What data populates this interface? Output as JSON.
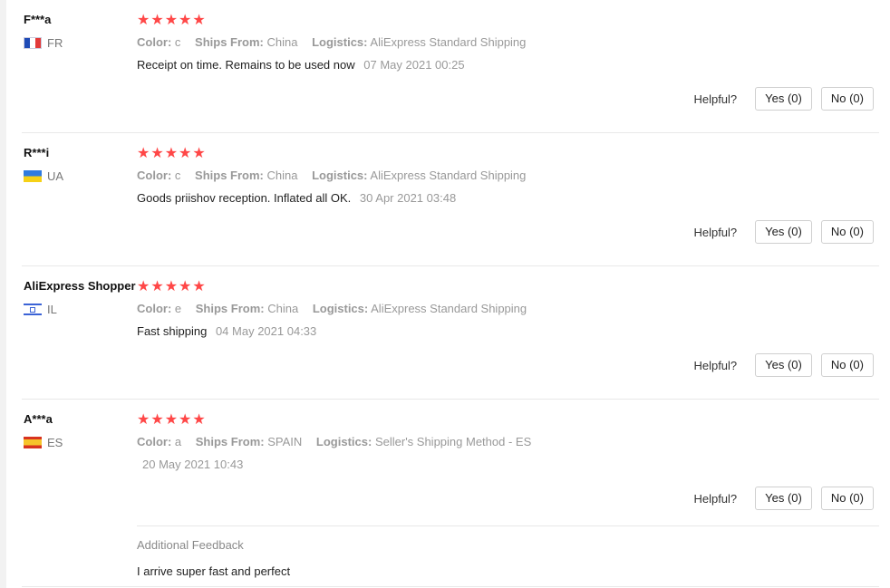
{
  "reviews": [
    {
      "user": "F***a",
      "country": "FR",
      "flag": "france-flag",
      "stars": "★★★★★",
      "rating": 5,
      "color_label": "Color:",
      "color_value": "c",
      "ships_label": "Ships From:",
      "ships_value": "China",
      "logistics_label": "Logistics:",
      "logistics_value": "AliExpress Standard Shipping",
      "comment": "Receipt on time. Remains to be used now",
      "date": "07 May 2021 00:25",
      "helpful_label": "Helpful?",
      "yes_label": "Yes (0)",
      "no_label": "No (0)"
    },
    {
      "user": "R***i",
      "country": "UA",
      "flag": "ukraine-flag",
      "stars": "★★★★★",
      "rating": 5,
      "color_label": "Color:",
      "color_value": "c",
      "ships_label": "Ships From:",
      "ships_value": "China",
      "logistics_label": "Logistics:",
      "logistics_value": "AliExpress Standard Shipping",
      "comment": "Goods priishov reception. Inflated all OK.",
      "date": "30 Apr 2021 03:48",
      "helpful_label": "Helpful?",
      "yes_label": "Yes (0)",
      "no_label": "No (0)"
    },
    {
      "user": "AliExpress Shopper",
      "country": "IL",
      "flag": "israel-flag",
      "stars": "★★★★★",
      "rating": 5,
      "color_label": "Color:",
      "color_value": "e",
      "ships_label": "Ships From:",
      "ships_value": "China",
      "logistics_label": "Logistics:",
      "logistics_value": "AliExpress Standard Shipping",
      "comment": "Fast shipping",
      "date": "04 May 2021 04:33",
      "helpful_label": "Helpful?",
      "yes_label": "Yes (0)",
      "no_label": "No (0)"
    },
    {
      "user": "A***a",
      "country": "ES",
      "flag": "spain-flag",
      "stars": "★★★★★",
      "rating": 5,
      "color_label": "Color:",
      "color_value": "a",
      "ships_label": "Ships From:",
      "ships_value": "SPAIN",
      "logistics_label": "Logistics:",
      "logistics_value": "Seller's Shipping Method - ES",
      "comment": "",
      "date": "20 May 2021 10:43",
      "helpful_label": "Helpful?",
      "yes_label": "Yes (0)",
      "no_label": "No (0)",
      "additional_title": "Additional Feedback",
      "additional_text": "I arrive super fast and perfect"
    }
  ],
  "colors": {
    "star": "#ff4747",
    "meta": "#999999",
    "divider": "#e8e8e8"
  }
}
